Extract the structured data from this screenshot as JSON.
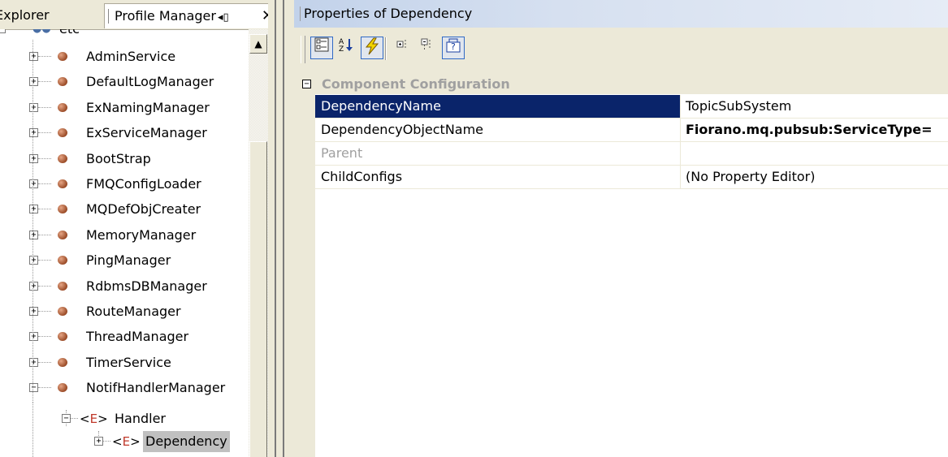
{
  "left_panel": {
    "tabs": {
      "explorer": "Explorer",
      "profile_manager": "Profile Manager"
    },
    "root_label": "etc",
    "tree_items": [
      "AdminService",
      "DefaultLogManager",
      "ExNamingManager",
      "ExServiceManager",
      "BootStrap",
      "FMQConfigLoader",
      "MQDefObjCreater",
      "MemoryManager",
      "PingManager",
      "RdbmsDBManager",
      "RouteManager",
      "ThreadManager",
      "TimerService",
      "NotifHandlerManager"
    ],
    "handler": {
      "tag": "E",
      "label": "Handler"
    },
    "dependency": {
      "tag": "E",
      "label": "Dependency"
    }
  },
  "right_panel": {
    "title": "Properties of Dependency",
    "category": "Component Configuration",
    "properties": [
      {
        "name": "DependencyName",
        "value": "TopicSubSystem"
      },
      {
        "name": "DependencyObjectName",
        "value": "Fiorano.mq.pubsub:ServiceType="
      },
      {
        "name": "Parent",
        "value": ""
      },
      {
        "name": "ChildConfigs",
        "value": "(No Property Editor)"
      }
    ]
  },
  "colors": {
    "selection": "#0a246a",
    "tree_selection": "#c0c0c0",
    "titlebar": "#c2d2ea"
  }
}
